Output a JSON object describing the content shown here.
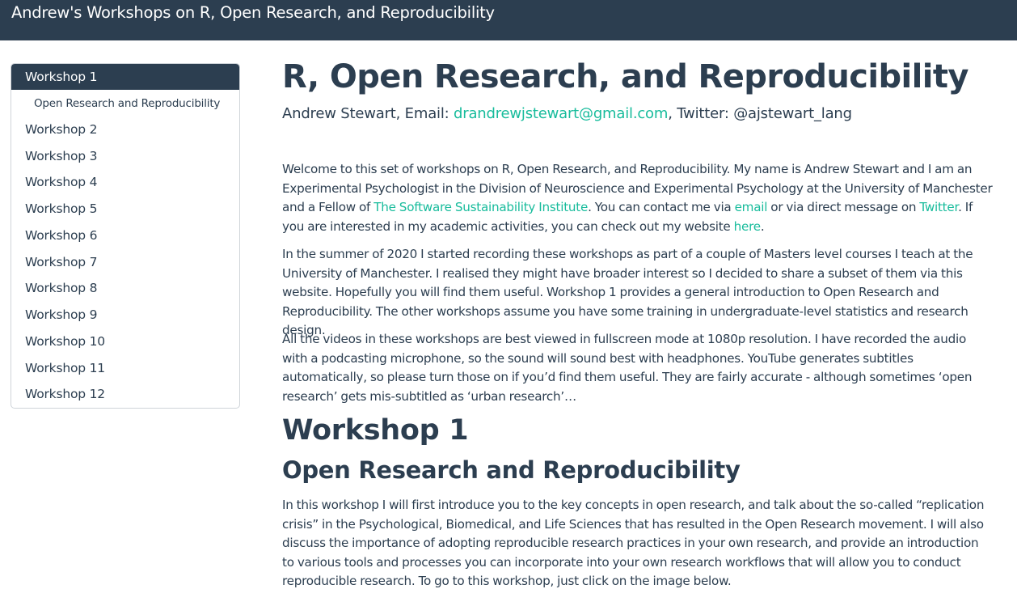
{
  "navbar": {
    "title": "Andrew's Workshops on R, Open Research, and Reproducibility"
  },
  "toc": {
    "active": "Workshop 1",
    "sub": "Open Research and Reproducibility",
    "items": [
      "Workshop 2",
      "Workshop 3",
      "Workshop 4",
      "Workshop 5",
      "Workshop 6",
      "Workshop 7",
      "Workshop 8",
      "Workshop 9",
      "Workshop 10",
      "Workshop 11",
      "Workshop 12"
    ]
  },
  "main": {
    "title": "R, Open Research, and Reproducibility",
    "author_prefix": "Andrew Stewart, Email: ",
    "email": "drandrewjstewart@gmail.com",
    "author_suffix": ", Twitter: @ajstewart_lang",
    "p1_a": "Welcome to this set of workshops on R, Open Research, and Reproducibility. My name is Andrew Stewart and I am an Experimental Psychologist in the Division of Neuroscience and Experimental Psychology at the University of Manchester and a Fellow of ",
    "p1_link_ssi": "The Software Sustainability Institute",
    "p1_b": ". You can contact me via ",
    "p1_link_email": "email",
    "p1_c": " or via direct message on ",
    "p1_link_twitter": "Twitter",
    "p1_d": ". If you are interested in my academic activities, you can check out my website ",
    "p1_link_here": "here",
    "p1_e": ".",
    "p2": "In the summer of 2020 I started recording these workshops as part of a couple of Masters level courses I teach at the University of Manchester. I realised they might have broader interest so I decided to share a subset of them via this website. Hopefully you will find them useful. Workshop 1 provides a general introduction to Open Research and Reproducibility. The other workshops assume you have some training in undergraduate-level statistics and research design.",
    "p3": "All the videos in these workshops are best viewed in fullscreen mode at 1080p resolution. I have recorded the audio with a podcasting microphone, so the sound will sound best with headphones. YouTube generates subtitles automatically, so please turn those on if you’d find them useful. They are fairly accurate - although sometimes ‘open research’ gets mis-subtitled as ‘urban research’…",
    "h1": "Workshop 1",
    "h2": "Open Research and Reproducibility",
    "p4": "In this workshop I will first introduce you to the key concepts in open research, and talk about the so-called “replication crisis” in the Psychological, Biomedical, and Life Sciences that has resulted in the Open Research movement. I will also discuss the importance of adopting reproducible research practices in your own research, and provide an introduction to various tools and processes you can incorporate into your own research workflows that will allow you to conduct reproducible research. To go to this workshop, just click on the image below."
  }
}
